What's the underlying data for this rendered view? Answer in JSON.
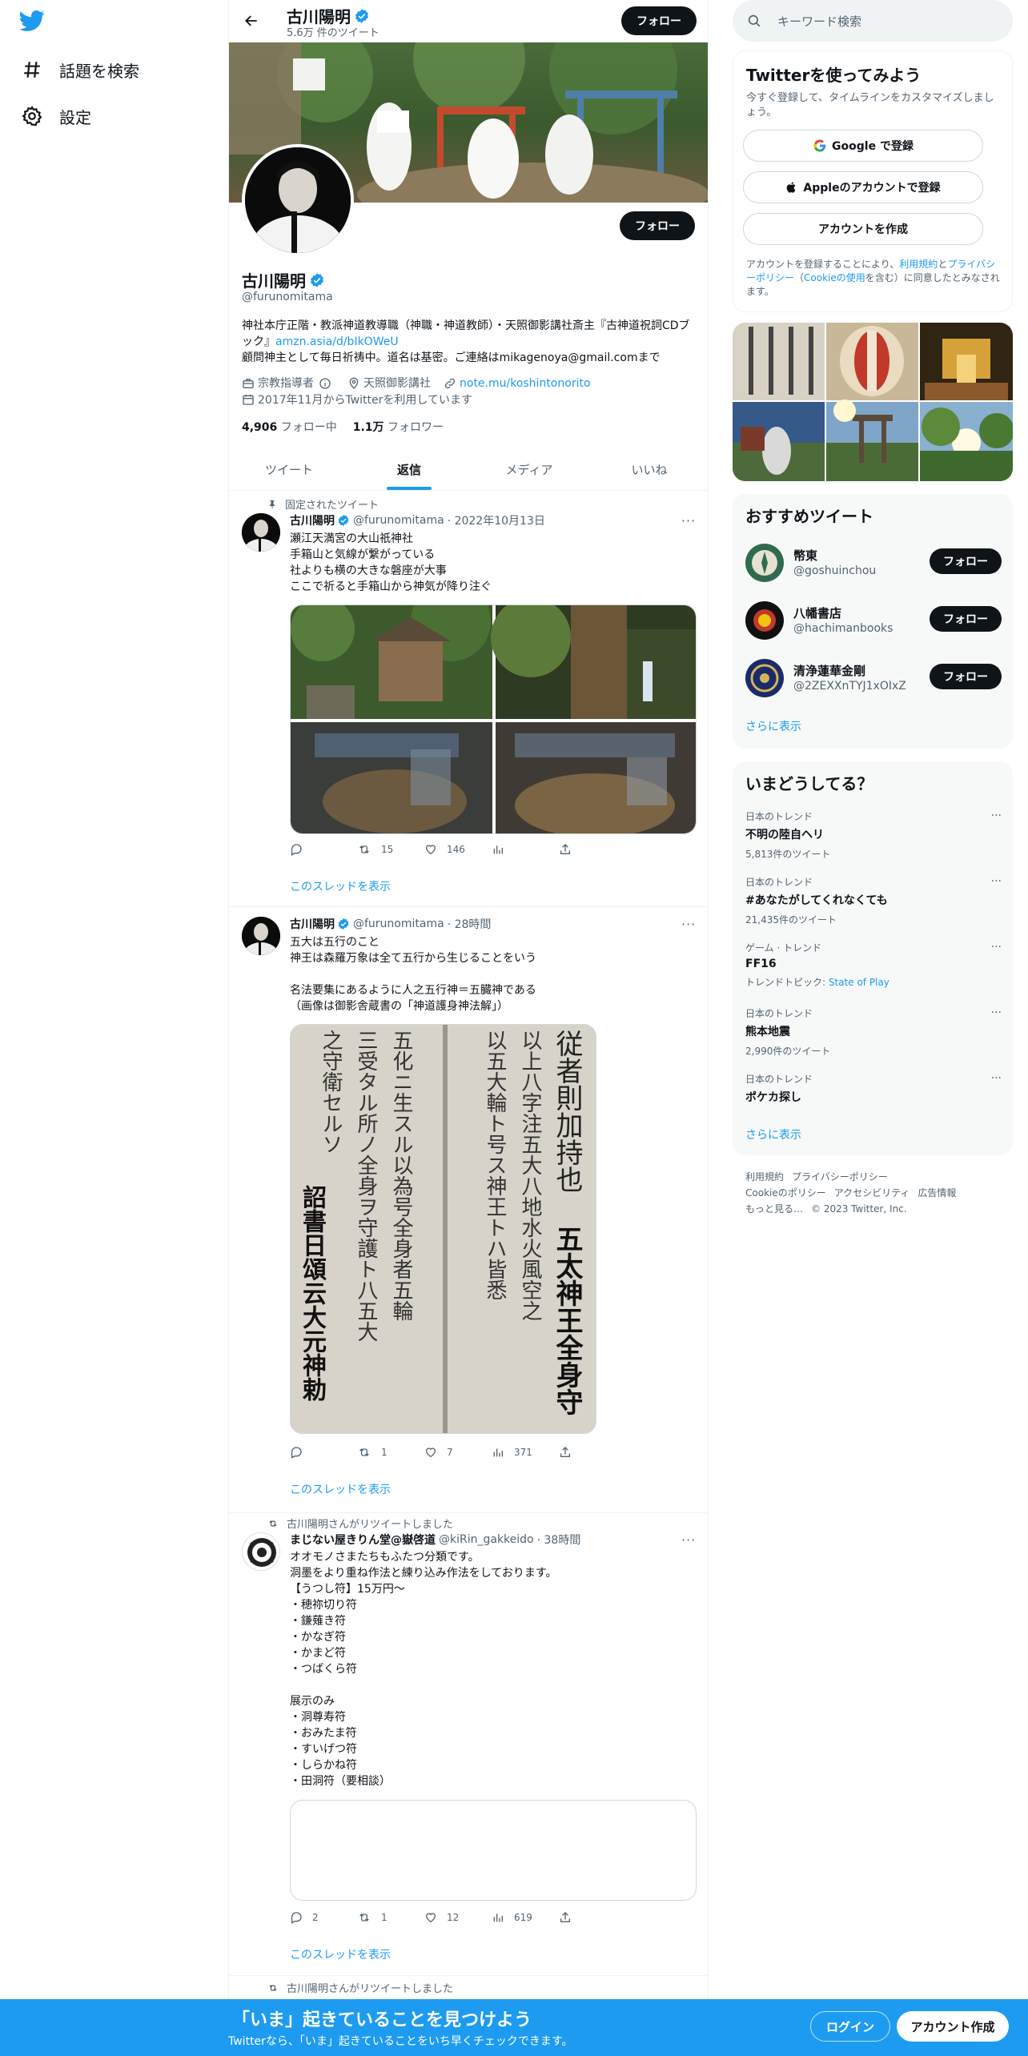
{
  "colors": {
    "accent": "#1d9bf0",
    "text": "#0f1419",
    "muted": "#536471"
  },
  "nav": {
    "items": [
      {
        "label": "話題を検索",
        "icon": "hashtag-icon"
      },
      {
        "label": "設定",
        "icon": "gear-icon"
      }
    ]
  },
  "header": {
    "name": "古川陽明",
    "tweet_count": "5.6万 件のツイート",
    "follow_label": "フォロー"
  },
  "profile": {
    "follow_label": "フォロー",
    "name": "古川陽明",
    "handle": "@furunomitama",
    "bio_line1": "神社本庁正階・教派神道教導職（神職・神道教師）・天照御影講社斎主『古神道祝詞CDブック』",
    "bio_link": "amzn.asia/d/bIkOWeU",
    "bio_line2": "顧問神主として毎日祈祷中。道名は基密。ご連絡はmikagenoya@gmail.comまで",
    "category": "宗教指導者",
    "location": "天照御影講社",
    "website": "note.mu/koshintonorito",
    "joined": "2017年11月からTwitterを利用しています",
    "following_count": "4,906",
    "following_label": "フォロー中",
    "followers_count": "1.1万",
    "followers_label": "フォロワー"
  },
  "tabs": [
    {
      "label": "ツイート",
      "active": false
    },
    {
      "label": "返信",
      "active": true
    },
    {
      "label": "メディア",
      "active": false
    },
    {
      "label": "いいね",
      "active": false
    }
  ],
  "tweets": [
    {
      "social": "固定されたツイート",
      "name": "古川陽明",
      "handle": "@furunomitama",
      "date": "· 2022年10月13日",
      "text": "瀬江天満宮の大山祇神社\n手箱山と気線が繋がっている\n社よりも横の大きな磐座が大事\nここで祈ると手箱山から神気が降り注ぐ",
      "reply": "",
      "retweet": "15",
      "like": "146",
      "views": "",
      "thread": "このスレッドを表示"
    },
    {
      "social": "",
      "name": "古川陽明",
      "handle": "@furunomitama",
      "date": "· 28時間",
      "text": "五大は五行のこと\n神王は森羅万象は全て五行から生じることをいう\n\n名法要集にあるように人之五行神＝五臓神である\n（画像は御影舎蔵書の「神道護身神法解」）",
      "reply": "",
      "retweet": "1",
      "like": "7",
      "views": "371",
      "thread": "このスレッドを表示",
      "manuscript_text": [
        "従者則加持也",
        "五太神王全身守",
        "以上八字注五大八地水火風空之",
        "以五大輪ト号ス神王トハ皆悉",
        "五化ニ生スル以為号全身者五輪",
        "三受タル所ノ全身ヲ守護ト八五大",
        "之守衛セルソ",
        "詔書日頌云大元神勅"
      ]
    },
    {
      "social": "古川陽明さんがリツイートしました",
      "name": "まじない屋きりん堂@嶽啓道",
      "handle": "@kiRin_gakkeido",
      "date": "· 38時間",
      "text": "オオモノさまたちもふたつ分類です。\n洞墨をより重ね作法と練り込み作法をしております。\n【うつし符】15万円～\n・穂祢切り符\n・鎌薙き符\n・かなぎ符\n・かまど符\n・つばくら符\n\n展示のみ\n・洞尊寿符\n・おみたま符\n・すいげつ符\n・しらかね符\n・田洞符（要相談）",
      "reply": "2",
      "retweet": "1",
      "like": "12",
      "views": "619",
      "thread": "このスレッドを表示"
    },
    {
      "social": "古川陽明さんがリツイートしました"
    }
  ],
  "search": {
    "placeholder": "キーワード検索"
  },
  "signup_card": {
    "title": "Twitterを使ってみよう",
    "subtitle": "今すぐ登録して、タイムラインをカスタマイズしましょう。",
    "google_label": "Google で登録",
    "apple_label": "Appleのアカウントで登録",
    "create_label": "アカウントを作成",
    "legal_pre": "アカウントを登録することにより、",
    "terms": "利用規約",
    "and": "と",
    "privacy": "プライバシーポリシー",
    "paren_open": "（",
    "cookie": "Cookieの使用",
    "legal_post": "を含む）に同意したとみなされます。"
  },
  "recommend": {
    "title": "おすすめツイート",
    "accounts": [
      {
        "name": "幣東",
        "handle": "@goshuinchou",
        "follow": "フォロー"
      },
      {
        "name": "八幡書店",
        "handle": "@hachimanbooks",
        "follow": "フォロー"
      },
      {
        "name": "清浄蓮華金剛",
        "handle": "@2ZEXXnTYJ1xOIxZ",
        "follow": "フォロー"
      }
    ],
    "more": "さらに表示"
  },
  "trends": {
    "title": "いまどうしてる？",
    "items": [
      {
        "category": "日本のトレンド",
        "topic": "不明の陸自ヘリ",
        "stat": "5,813件のツイート"
      },
      {
        "category": "日本のトレンド",
        "topic": "#あなたがしてくれなくても",
        "stat": "21,435件のツイート"
      },
      {
        "category": "ゲーム · トレンド",
        "topic": "FF16",
        "stat": "トレンドトピック: ",
        "stat_link": "State of Play"
      },
      {
        "category": "日本のトレンド",
        "topic": "熊本地震",
        "stat": "2,990件のツイート"
      },
      {
        "category": "日本のトレンド",
        "topic": "ポケカ探し",
        "stat": ""
      }
    ],
    "more": "さらに表示"
  },
  "footer": {
    "links": [
      "利用規約",
      "プライバシーポリシー",
      "Cookieのポリシー",
      "アクセシビリティ",
      "広告情報",
      "もっと見る…"
    ],
    "copyright": "© 2023 Twitter, Inc."
  },
  "bottom_bar": {
    "title": "「いま」起きていることを見つけよう",
    "subtitle": "Twitterなら、「いま」起きていることをいち早くチェックできます。",
    "login": "ログイン",
    "signup": "アカウント作成"
  }
}
